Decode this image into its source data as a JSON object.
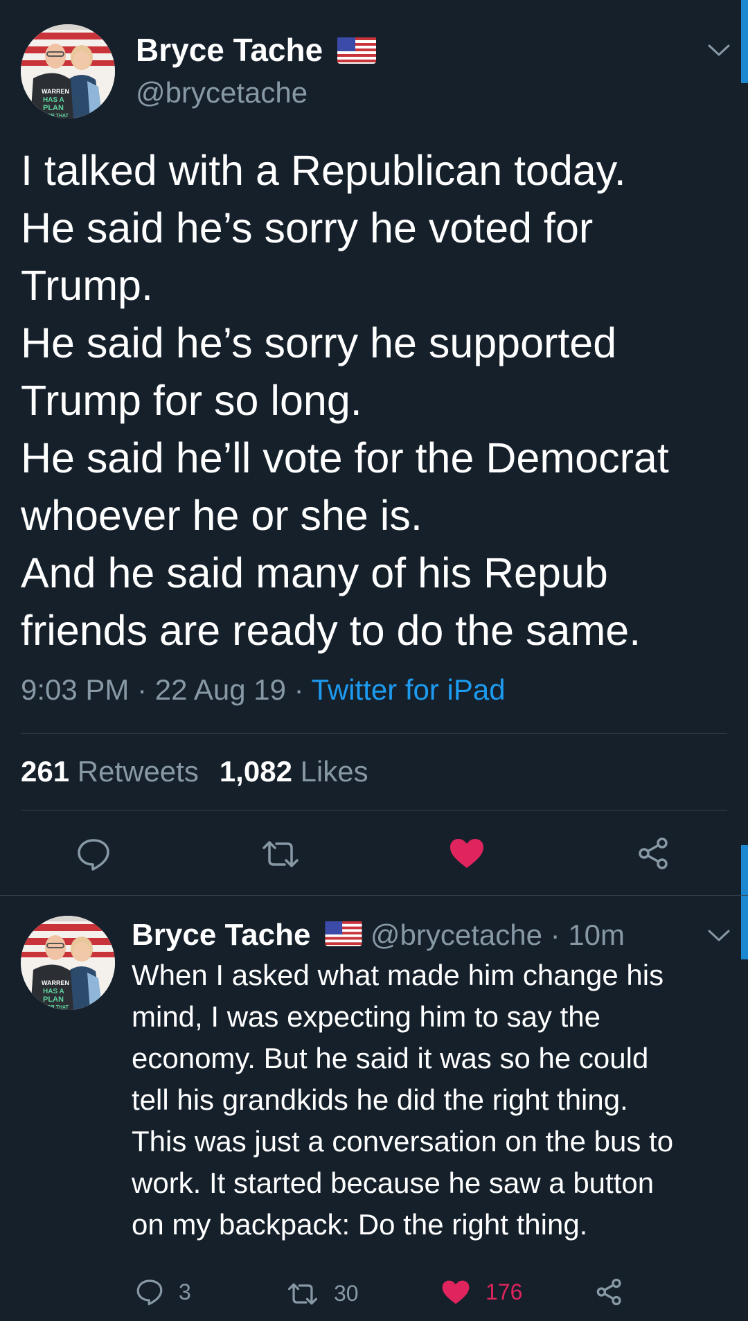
{
  "main_tweet": {
    "display_name": "Bryce Tache",
    "handle": "@brycetache",
    "avatar_shirt_text": [
      "WARREN",
      "HAS A",
      "PLAN",
      "FOR THAT"
    ],
    "text_lines": [
      "I talked with a Republican today.",
      "He said he’s sorry he voted for",
      "Trump.",
      "He said he’s sorry he supported",
      "Trump for so long.",
      "He said he’ll vote for the Democrat",
      "whoever he or she is.",
      "And he said many of his Repub",
      "friends are ready to do the same."
    ],
    "time": "9:03 PM",
    "separator": " · ",
    "date": "22 Aug 19",
    "source": "Twitter for iPad",
    "retweets_count": "261",
    "retweets_label": "Retweets",
    "likes_count": "1,082",
    "likes_label": "Likes",
    "liked": true
  },
  "reply_tweet": {
    "display_name": "Bryce Tache",
    "handle_time": "@brycetache · 10m",
    "text_lines": [
      "When I asked what made him change his",
      "mind, I was expecting him to say the",
      "economy. But he said it was so he could",
      "tell his grandkids he did the right thing.",
      "This was just a conversation on the bus to",
      "work. It started because he saw a button",
      "on my backpack: Do the right thing."
    ],
    "reply_count": "3",
    "retweet_count": "30",
    "like_count": "176",
    "liked": true
  },
  "colors": {
    "background": "#15202b",
    "text_primary": "#ffffff",
    "text_secondary": "#8899a6",
    "link": "#1d9bf0",
    "like": "#e0245e",
    "divider": "#38444d"
  },
  "icons": {
    "reply": "reply-icon",
    "retweet": "retweet-icon",
    "like": "heart-icon",
    "share": "share-icon",
    "menu": "chevron-down-icon",
    "flag": "us-flag-icon"
  }
}
